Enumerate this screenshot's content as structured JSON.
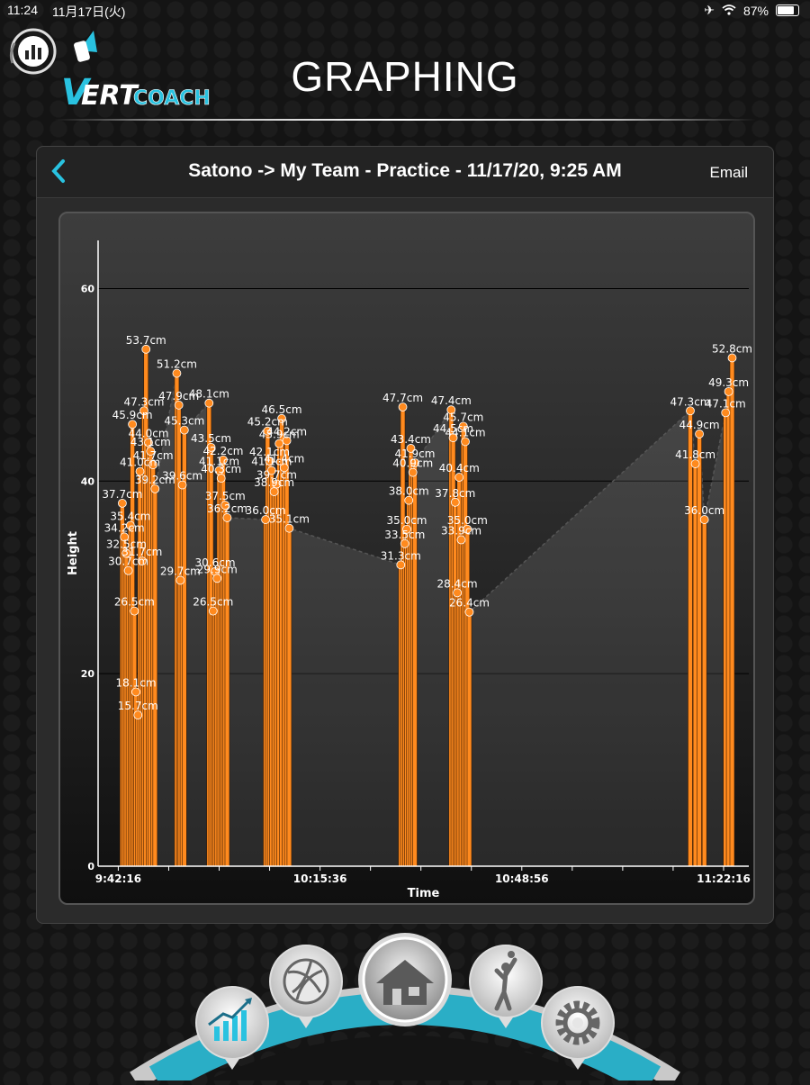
{
  "status_bar": {
    "time": "11:24",
    "date": "11月17日(火)",
    "battery": "87%"
  },
  "header": {
    "title": "GRAPHING",
    "logo_word": "ERT",
    "logo_sub": "COACH"
  },
  "panel": {
    "back_label": "<",
    "title": "Satono -> My Team - Practice - 11/17/20, 9:25 AM",
    "email_label": "Email"
  },
  "nav": {
    "items": [
      {
        "id": "graphing",
        "icon": "growth-chart-icon"
      },
      {
        "id": "volleyball",
        "icon": "volleyball-icon"
      },
      {
        "id": "home",
        "icon": "house-icon"
      },
      {
        "id": "athlete",
        "icon": "athlete-icon"
      },
      {
        "id": "settings",
        "icon": "gear-icon"
      }
    ]
  },
  "colors": {
    "accent": "#29c2e0",
    "bar": "#ff8a1e",
    "point": "#ff8a1e"
  },
  "chart_data": {
    "type": "bar",
    "xlabel": "Time",
    "ylabel": "Height",
    "ylim": [
      0,
      65
    ],
    "yticks": [
      0,
      20,
      40,
      60
    ],
    "xticks": [
      {
        "t": 0,
        "label": "9:42:16"
      },
      {
        "t": 2000,
        "label": "10:15:36"
      },
      {
        "t": 4000,
        "label": "10:48:56"
      },
      {
        "t": 6000,
        "label": "11:22:16"
      }
    ],
    "xlim": [
      -200,
      6250
    ],
    "grid": true,
    "points": [
      {
        "t": 40,
        "v": 37.7,
        "label": "37.7cm"
      },
      {
        "t": 60,
        "v": 34.2,
        "label": "34.2cm"
      },
      {
        "t": 80,
        "v": 32.5,
        "label": "32.5cm"
      },
      {
        "t": 100,
        "v": 30.7,
        "label": "30.7cm"
      },
      {
        "t": 120,
        "v": 35.4,
        "label": "35.4cm"
      },
      {
        "t": 140,
        "v": 45.9,
        "label": "45.9cm"
      },
      {
        "t": 160,
        "v": 26.5,
        "label": "26.5cm"
      },
      {
        "t": 175,
        "v": 18.1,
        "label": "18.1cm"
      },
      {
        "t": 195,
        "v": 15.7,
        "label": "15.7cm"
      },
      {
        "t": 215,
        "v": 41.0,
        "label": "41.0cm"
      },
      {
        "t": 235,
        "v": 31.7,
        "label": "31.7cm"
      },
      {
        "t": 255,
        "v": 47.3,
        "label": "47.3cm"
      },
      {
        "t": 275,
        "v": 53.7,
        "label": "53.7cm"
      },
      {
        "t": 300,
        "v": 44.0,
        "label": "44.0cm"
      },
      {
        "t": 320,
        "v": 43.1,
        "label": "43.1cm"
      },
      {
        "t": 345,
        "v": 41.7,
        "label": "41.7cm"
      },
      {
        "t": 365,
        "v": 39.2,
        "label": "39.2cm"
      },
      {
        "t": 580,
        "v": 51.2,
        "label": "51.2cm"
      },
      {
        "t": 600,
        "v": 47.9,
        "label": "47.9cm"
      },
      {
        "t": 615,
        "v": 29.7,
        "label": "29.7cm"
      },
      {
        "t": 635,
        "v": 39.6,
        "label": "39.6cm"
      },
      {
        "t": 655,
        "v": 45.3,
        "label": "45.3cm"
      },
      {
        "t": 900,
        "v": 48.1,
        "label": "48.1cm"
      },
      {
        "t": 920,
        "v": 43.5,
        "label": "43.5cm"
      },
      {
        "t": 940,
        "v": 26.5,
        "label": "26.5cm"
      },
      {
        "t": 960,
        "v": 30.6,
        "label": "30.6cm"
      },
      {
        "t": 980,
        "v": 29.9,
        "label": "29.9cm"
      },
      {
        "t": 1000,
        "v": 41.1,
        "label": "41.1cm"
      },
      {
        "t": 1020,
        "v": 40.3,
        "label": "40.3cm"
      },
      {
        "t": 1040,
        "v": 42.2,
        "label": "42.2cm"
      },
      {
        "t": 1060,
        "v": 37.5,
        "label": "37.5cm"
      },
      {
        "t": 1080,
        "v": 36.2,
        "label": "36.2cm"
      },
      {
        "t": 1460,
        "v": 36.0,
        "label": "36.0cm"
      },
      {
        "t": 1480,
        "v": 45.2,
        "label": "45.2cm"
      },
      {
        "t": 1500,
        "v": 42.1,
        "label": "42.1cm"
      },
      {
        "t": 1520,
        "v": 41.1,
        "label": "41.1cm"
      },
      {
        "t": 1545,
        "v": 38.9,
        "label": "38.9cm"
      },
      {
        "t": 1570,
        "v": 39.7,
        "label": "39.7cm"
      },
      {
        "t": 1595,
        "v": 43.9,
        "label": "43.9cm"
      },
      {
        "t": 1620,
        "v": 46.5,
        "label": "46.5cm"
      },
      {
        "t": 1645,
        "v": 41.4,
        "label": "41.4cm"
      },
      {
        "t": 1670,
        "v": 44.2,
        "label": "44.2cm"
      },
      {
        "t": 1695,
        "v": 35.1,
        "label": "35.1cm"
      },
      {
        "t": 2800,
        "v": 31.3,
        "label": "31.3cm"
      },
      {
        "t": 2820,
        "v": 47.7,
        "label": "47.7cm"
      },
      {
        "t": 2840,
        "v": 33.5,
        "label": "33.5cm"
      },
      {
        "t": 2860,
        "v": 35.0,
        "label": "35.0cm"
      },
      {
        "t": 2880,
        "v": 38.0,
        "label": "38.0cm"
      },
      {
        "t": 2900,
        "v": 43.4,
        "label": "43.4cm"
      },
      {
        "t": 2920,
        "v": 40.9,
        "label": "40.9cm"
      },
      {
        "t": 2940,
        "v": 41.9,
        "label": "41.9cm"
      },
      {
        "t": 3300,
        "v": 47.4,
        "label": "47.4cm"
      },
      {
        "t": 3320,
        "v": 44.5,
        "label": "44.5cm"
      },
      {
        "t": 3340,
        "v": 37.8,
        "label": "37.8cm"
      },
      {
        "t": 3360,
        "v": 28.4,
        "label": "28.4cm"
      },
      {
        "t": 3380,
        "v": 40.4,
        "label": "40.4cm"
      },
      {
        "t": 3400,
        "v": 33.9,
        "label": "33.9cm"
      },
      {
        "t": 3420,
        "v": 45.7,
        "label": "45.7cm"
      },
      {
        "t": 3440,
        "v": 44.1,
        "label": "44.1cm"
      },
      {
        "t": 3460,
        "v": 35.0,
        "label": "35.0cm"
      },
      {
        "t": 3480,
        "v": 26.4,
        "label": "26.4cm"
      },
      {
        "t": 5670,
        "v": 47.3,
        "label": "47.3cm"
      },
      {
        "t": 5720,
        "v": 41.8,
        "label": "41.8cm"
      },
      {
        "t": 5760,
        "v": 44.9,
        "label": "44.9cm"
      },
      {
        "t": 5810,
        "v": 36.0,
        "label": "36.0cm"
      },
      {
        "t": 6020,
        "v": 47.1,
        "label": "47.1cm"
      },
      {
        "t": 6050,
        "v": 49.3,
        "label": "49.3cm"
      },
      {
        "t": 6085,
        "v": 52.8,
        "label": "52.8cm"
      }
    ]
  }
}
